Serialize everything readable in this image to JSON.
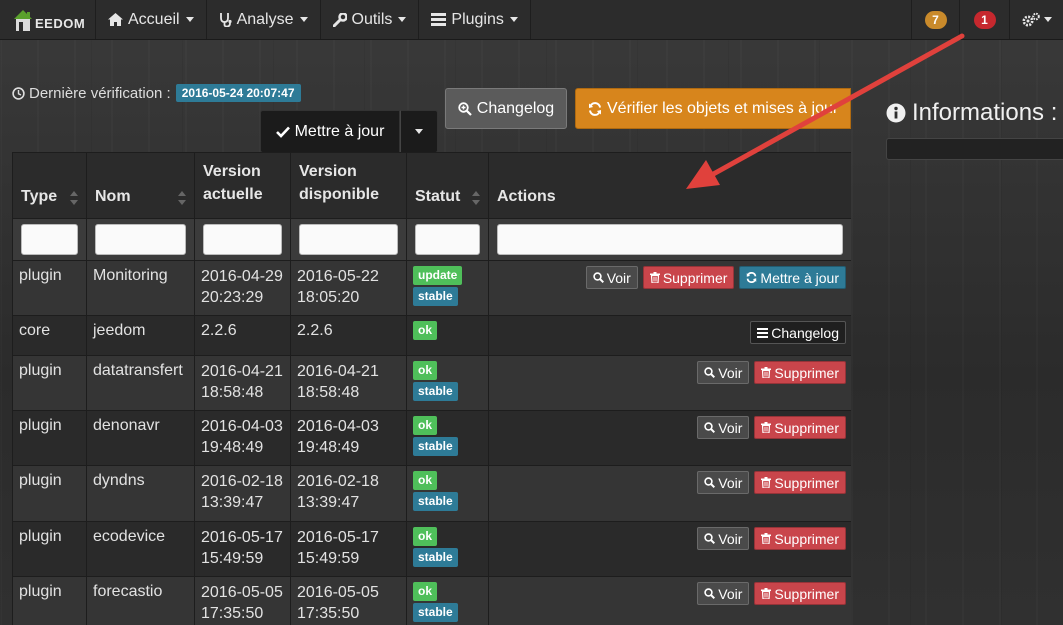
{
  "navbar": {
    "brand_text": "EEDOM",
    "items": [
      {
        "label": "Accueil",
        "icon": "home-icon"
      },
      {
        "label": "Analyse",
        "icon": "stethoscope-icon"
      },
      {
        "label": "Outils",
        "icon": "wrench-icon"
      },
      {
        "label": "Plugins",
        "icon": "tasks-icon"
      }
    ],
    "badge_warning": "7",
    "badge_danger": "1",
    "colors": {
      "warning": "#c98a2b",
      "danger": "#c6282e"
    }
  },
  "last_check": {
    "label": "Dernière vérification :",
    "date": "2016-05-24 20:07:47"
  },
  "toolbar": {
    "changelog_label": "Changelog",
    "verify_label": "Vérifier les objets et mises à jour",
    "update_label": "Mettre à jour"
  },
  "table": {
    "headers": {
      "type": "Type",
      "name": "Nom",
      "current_line1": "Version",
      "current_line2": "actuelle",
      "available_line1": "Version",
      "available_line2": "disponible",
      "status": "Statut",
      "actions": "Actions"
    },
    "rows": [
      {
        "type": "plugin",
        "name": "Monitoring",
        "current_date": "2016-04-29",
        "current_time": "20:23:29",
        "available_date": "2016-05-22",
        "available_time": "18:05:20",
        "status": "update",
        "channel": "stable"
      },
      {
        "type": "core",
        "name": "jeedom",
        "current_date": "2.2.6",
        "current_time": "",
        "available_date": "2.2.6",
        "available_time": "",
        "status": "ok",
        "channel": ""
      },
      {
        "type": "plugin",
        "name": "datatransfert",
        "current_date": "2016-04-21",
        "current_time": "18:58:48",
        "available_date": "2016-04-21",
        "available_time": "18:58:48",
        "status": "ok",
        "channel": "stable"
      },
      {
        "type": "plugin",
        "name": "denonavr",
        "current_date": "2016-04-03",
        "current_time": "19:48:49",
        "available_date": "2016-04-03",
        "available_time": "19:48:49",
        "status": "ok",
        "channel": "stable"
      },
      {
        "type": "plugin",
        "name": "dyndns",
        "current_date": "2016-02-18",
        "current_time": "13:39:47",
        "available_date": "2016-02-18",
        "available_time": "13:39:47",
        "status": "ok",
        "channel": "stable"
      },
      {
        "type": "plugin",
        "name": "ecodevice",
        "current_date": "2016-05-17",
        "current_time": "15:49:59",
        "available_date": "2016-05-17",
        "available_time": "15:49:59",
        "status": "ok",
        "channel": "stable"
      },
      {
        "type": "plugin",
        "name": "forecastio",
        "current_date": "2016-05-05",
        "current_time": "17:35:50",
        "available_date": "2016-05-05",
        "available_time": "17:35:50",
        "status": "ok",
        "channel": "stable"
      }
    ],
    "actions": {
      "view": "Voir",
      "delete": "Supprimer",
      "update": "Mettre à jour",
      "changelog": "Changelog"
    }
  },
  "info_panel": {
    "title": "Informations :"
  },
  "colors": {
    "accent_orange": "#d7851c",
    "label_green": "#4fbf5a",
    "label_blue": "#2e7b97",
    "danger_red": "#c9454b",
    "arrow_red": "#e0413c"
  }
}
